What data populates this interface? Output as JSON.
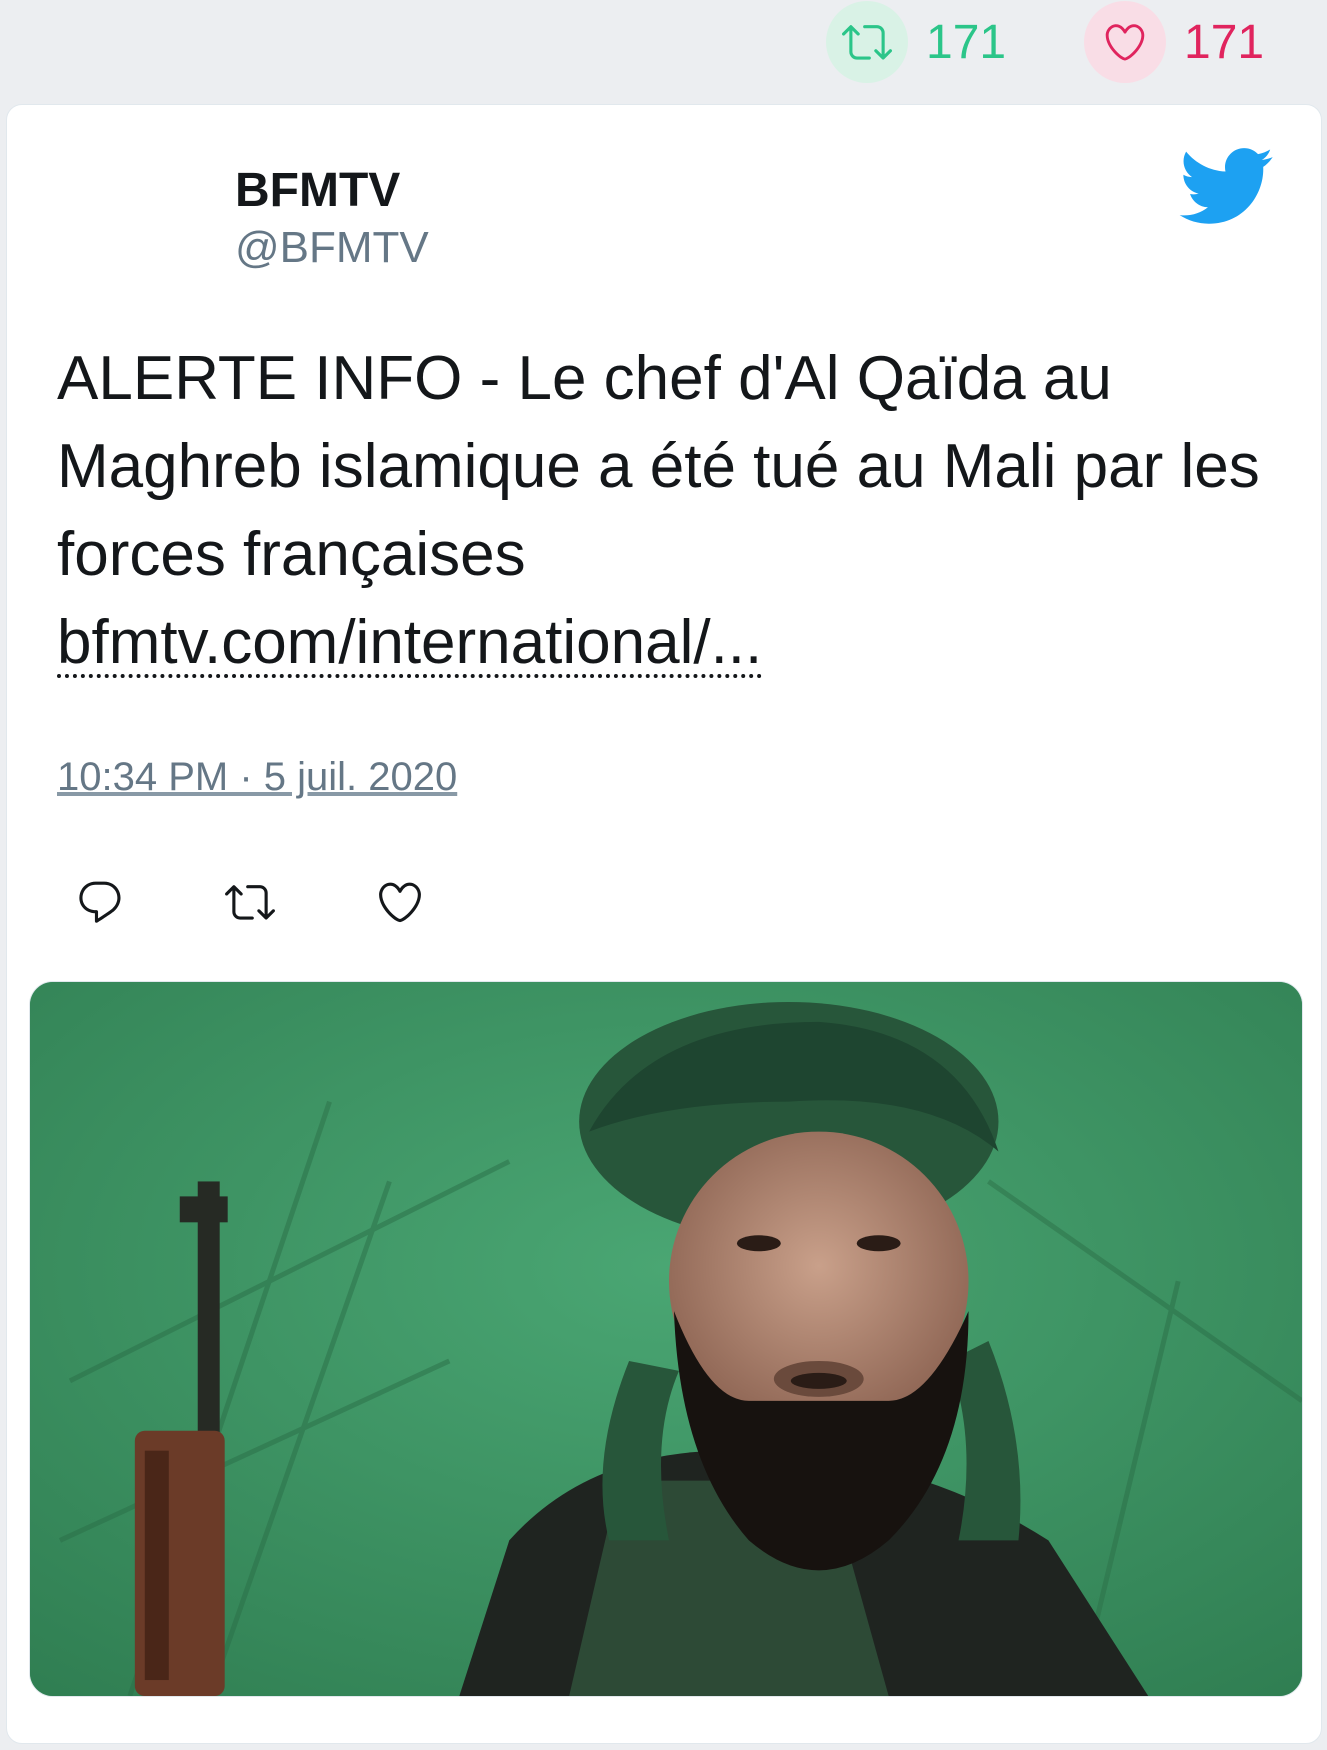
{
  "top_stats": {
    "retweet_count": "171",
    "like_count": "171",
    "retweet_icon": "retweet-icon",
    "like_icon": "heart-icon"
  },
  "tweet": {
    "author_name": "BFMTV",
    "author_handle": "@BFMTV",
    "logo_icon": "twitter-bird-icon",
    "text": "ALERTE INFO - Le chef d'Al Qaïda au Maghreb islamique a été tué au Mali par les forces françaises",
    "link": "bfmtv.com/international/...",
    "timestamp": "10:34 PM · 5 juil. 2020",
    "actions": [
      "reply-icon",
      "retweet-icon",
      "heart-icon"
    ]
  },
  "colors": {
    "retweet_green": "#2bc589",
    "like_red": "#e0245e",
    "twitter_blue": "#1da1f2",
    "secondary_text": "#657786"
  }
}
